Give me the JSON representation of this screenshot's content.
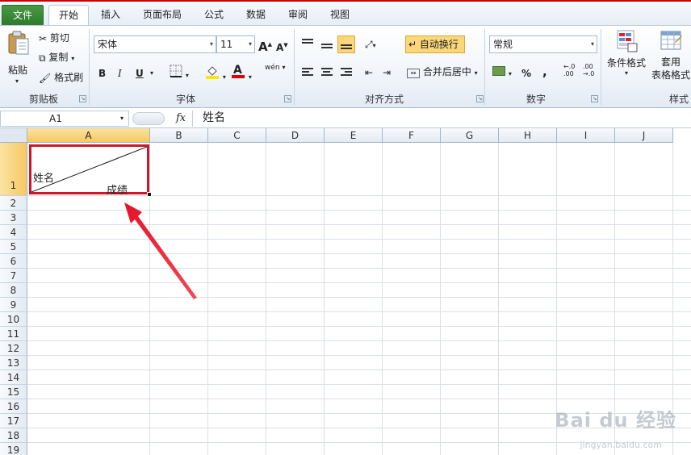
{
  "tabs": {
    "file": "文件",
    "home": "开始",
    "insert": "插入",
    "page_layout": "页面布局",
    "formulas": "公式",
    "data": "数据",
    "review": "审阅",
    "view": "视图"
  },
  "ribbon": {
    "clipboard": {
      "paste": "粘贴",
      "cut": "剪切",
      "copy": "复制",
      "format_painter": "格式刷",
      "title": "剪贴板"
    },
    "font": {
      "font_name": "宋体",
      "font_size": "11",
      "bold": "B",
      "italic": "I",
      "underline": "U",
      "grow": "A",
      "shrink": "A",
      "phonetic": "wén",
      "title": "字体"
    },
    "alignment": {
      "wrap_text": "自动换行",
      "merge_center": "合并后居中",
      "title": "对齐方式"
    },
    "number": {
      "format": "常规",
      "percent": "%",
      "comma": ",",
      "title": "数字"
    },
    "styles": {
      "conditional": "条件格式",
      "table_format_1": "套用",
      "table_format_2": "表格格式",
      "title": "样式"
    }
  },
  "formula_bar": {
    "name_box": "A1",
    "fx": "fx",
    "content": "姓名"
  },
  "sheet": {
    "columns": [
      "A",
      "B",
      "C",
      "D",
      "E",
      "F",
      "G",
      "H",
      "I",
      "J"
    ],
    "rows": [
      "1",
      "2",
      "3",
      "4",
      "5",
      "6",
      "7",
      "8",
      "9",
      "10",
      "11",
      "12",
      "13",
      "14",
      "15",
      "16",
      "17",
      "18",
      "19"
    ],
    "a1_left": "姓名",
    "a1_right": "成绩"
  },
  "watermark": {
    "brand": "Bai du 经验",
    "url": "jingyan.baidu.com"
  },
  "colors": {
    "accent_red": "#d0162b",
    "file_tab_green": "#2c7a2a",
    "selection_header": "#f6c862"
  }
}
